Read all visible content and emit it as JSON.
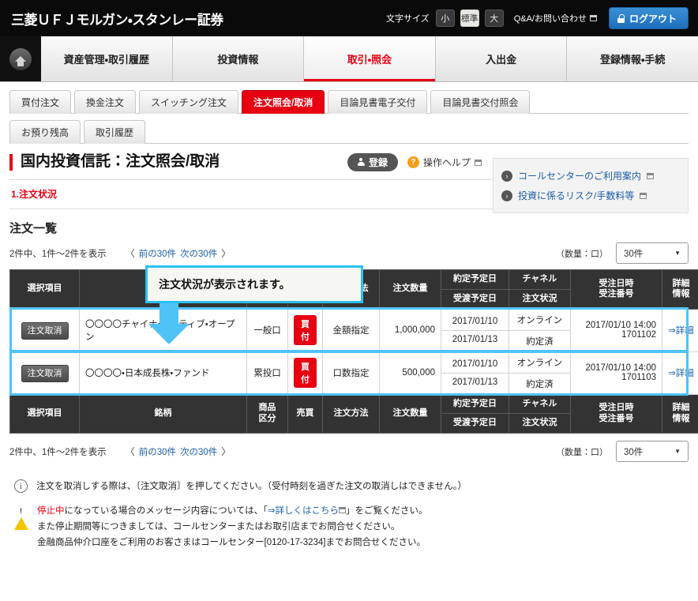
{
  "header": {
    "brand": "三菱ＵＦＪモルガン・スタンレー証券",
    "fontsize_label": "文字サイズ",
    "fontsize_small": "小",
    "fontsize_medium": "標準",
    "fontsize_large": "大",
    "qa_label": "Q&A/お問い合わせ",
    "logout_label": "ログアウト"
  },
  "gnav": {
    "home": "ホーム",
    "items": [
      {
        "label": "資産管理・取引履歴",
        "active": false
      },
      {
        "label": "投資情報",
        "active": false
      },
      {
        "label": "取引・照会",
        "active": true
      },
      {
        "label": "入出金",
        "active": false
      },
      {
        "label": "登録情報・手続",
        "active": false
      }
    ]
  },
  "tabs_row1": [
    {
      "label": "買付注文",
      "active": false
    },
    {
      "label": "換金注文",
      "active": false
    },
    {
      "label": "スイッチング注文",
      "active": false
    },
    {
      "label": "注文照会/取消",
      "active": true
    },
    {
      "label": "目論見書電子交付",
      "active": false
    },
    {
      "label": "目論見書交付照会",
      "active": false
    }
  ],
  "tabs_row2": [
    {
      "label": "お預り残高",
      "active": false
    },
    {
      "label": "取引履歴",
      "active": false
    }
  ],
  "page": {
    "title": "国内投資信託：注文照会/取消",
    "register_label": "登録",
    "help_label": "操作ヘルプ",
    "step_label": "1.注文状況"
  },
  "info_panel": {
    "links": [
      "コールセンターのご利用案内",
      "投資に係るリスク/手数料等"
    ]
  },
  "callout": {
    "text": "注文状況が表示されます。",
    "border_color": "#29c1f2"
  },
  "order_list": {
    "heading": "注文一覧",
    "pager": {
      "count_text": "2件中、1件〜2件を表示",
      "prev_arrow": "〈",
      "prev_label": "前の30件",
      "next_label": "次の30件",
      "next_arrow": "〉",
      "unit_label": "（数量：口）",
      "page_size": "30件"
    },
    "columns": {
      "select": "選択項目",
      "name": "銘柄",
      "product_type_line1": "商品",
      "product_type_line2": "区分",
      "trade": "売買",
      "method": "注文方法",
      "quantity": "注文数量",
      "contract_date": "約定予定日",
      "settle_date": "受渡予定日",
      "channel": "チャネル",
      "status": "注文状況",
      "order_dt_line1": "受注日時",
      "order_dt_line2": "受注番号",
      "detail_line1": "詳細",
      "detail_line2": "情報"
    },
    "rows": [
      {
        "cancel_label": "注文取消",
        "name": "〇〇〇〇チャイナ・アクティブ・オープン",
        "product_type": "一般口",
        "trade": "買付",
        "method": "金額指定",
        "quantity": "1,000,000",
        "contract_date": "2017/01/10",
        "settle_date": "2017/01/13",
        "channel": "オンライン",
        "status": "約定済",
        "order_datetime": "2017/01/10 14:00",
        "order_number": "1701102",
        "detail_label": "⇒詳細"
      },
      {
        "cancel_label": "注文取消",
        "name": "〇〇〇〇・日本成長株・ファンド",
        "product_type": "累投口",
        "trade": "買付",
        "method": "口数指定",
        "quantity": "500,000",
        "contract_date": "2017/01/10",
        "settle_date": "2017/01/13",
        "channel": "オンライン",
        "status": "約定済",
        "order_datetime": "2017/01/10 14:00",
        "order_number": "1701103",
        "detail_label": "⇒詳細"
      }
    ]
  },
  "notes": [
    {
      "icon": "info-icon",
      "text": "注文を取消しする際は、〔注文取消〕を押してください。（受付時刻を過ぎた注文の取消しはできません。）"
    }
  ],
  "warning_note": {
    "icon": "warning-icon",
    "line1_pre": "",
    "line1_red": "停止中",
    "line1_mid": "になっている場合のメッセージ内容については、「",
    "line1_link": "⇒詳しくはこちら",
    "line1_post": "」をご覧ください。",
    "line2": "また停止期間等につきましては、コールセンターまたはお取引店までお問合せください。",
    "line3": "金融商品仲介口座をご利用のお客さまはコールセンター[0120-17-3234]までお問合せください。"
  },
  "colors": {
    "accent_red": "#e60012",
    "link_blue": "#1c5fa8",
    "highlight_cyan": "#4fc3f7",
    "header_dark": "#333333"
  }
}
